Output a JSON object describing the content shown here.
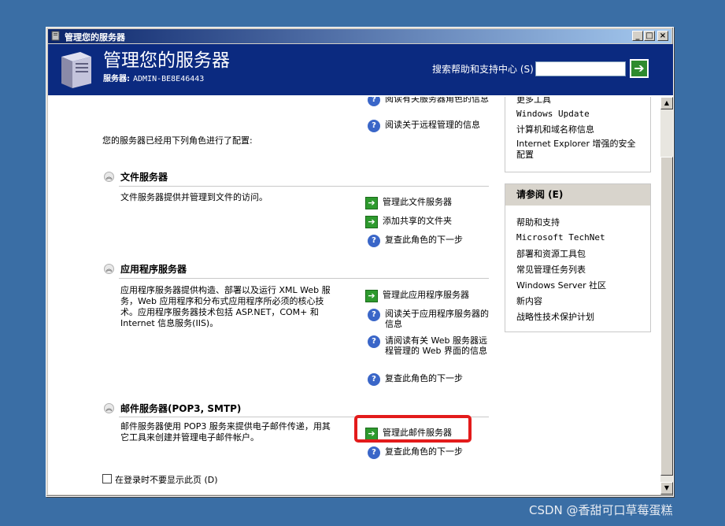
{
  "window": {
    "title": "管理您的服务器",
    "buttons": [
      "_",
      "□",
      "×"
    ]
  },
  "header": {
    "title": "管理您的服务器",
    "server_label": "服务器:",
    "server_name": "ADMIN-BE8E46443",
    "search_label": "搜索帮助和支持中心 (S)",
    "search_value": "",
    "search_go_icon": "green-arrow-icon"
  },
  "top_links": {
    "link1": "阅读有关服务器角色的信息",
    "link2": "阅读关于远程管理的信息"
  },
  "intro": "您的服务器已经用下列角色进行了配置:",
  "roles": [
    {
      "name": "文件服务器",
      "description": "文件服务器提供并管理到文件的访问。",
      "actions": [
        "管理此文件服务器",
        "添加共享的文件夹",
        "复查此角色的下一步"
      ]
    },
    {
      "name": "应用程序服务器",
      "description_lines": [
        "应用程序服务器提供构造、部署以及运行 XML Web 服",
        "务，Web 应用程序和分布式应用程序所必须的核心技",
        "术。应用程序服务器技术包括 ASP.NET，COM+ 和",
        "Internet 信息服务(IIS)。"
      ],
      "actions": [
        "管理此应用程序服务器",
        "阅读关于应用程序服务器的信息",
        "请阅读有关 Web 服务器远程管理的 Web 界面的信息",
        "复查此角色的下一步"
      ]
    },
    {
      "name": "邮件服务器(POP3, SMTP)",
      "description_lines": [
        "邮件服务器使用 POP3 服务来提供电子邮件传递，用其",
        "它工具来创建并管理电子邮件帐户。"
      ],
      "actions": [
        "管理此邮件服务器",
        "复查此角色的下一步"
      ]
    }
  ],
  "tools_panel": {
    "items": [
      "更多工具",
      "Windows Update",
      "计算机和域名称信息",
      "Internet Explorer 增强的安全配置"
    ]
  },
  "see_also": {
    "heading": "请参阅 (E)",
    "items": [
      "帮助和支持",
      "Microsoft TechNet",
      "部署和资源工具包",
      "常见管理任务列表",
      "Windows Server 社区",
      "新内容",
      "战略性技术保护计划"
    ]
  },
  "footer": {
    "dont_show_label": "在登录时不要显示此页 (D)",
    "checked": false
  },
  "watermark": "CSDN @香甜可口草莓蛋糕"
}
